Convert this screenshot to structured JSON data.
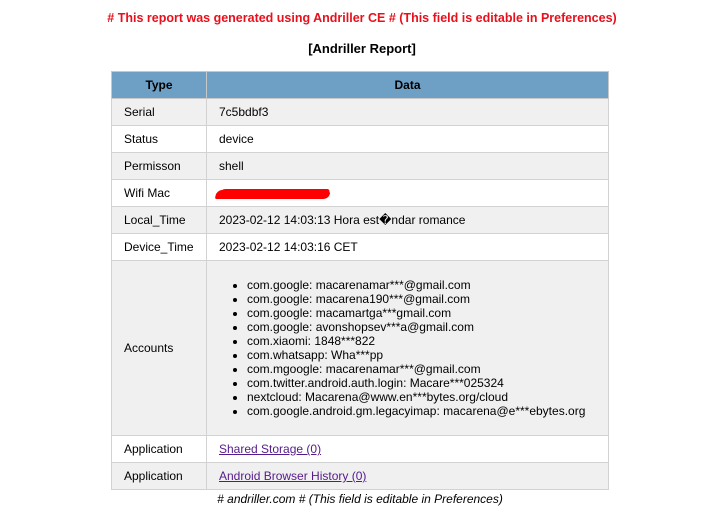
{
  "header": {
    "notice": "# This report was generated using Andriller CE # (This field is editable in Preferences)",
    "title": "[Andriller Report]"
  },
  "table": {
    "columns": [
      "Type",
      "Data"
    ],
    "rows": {
      "serial": {
        "type": "Serial",
        "data": "7c5bdbf3"
      },
      "status": {
        "type": "Status",
        "data": "device"
      },
      "permission": {
        "type": "Permisson",
        "data": "shell"
      },
      "wifi_mac": {
        "type": "Wifi Mac",
        "data": ""
      },
      "local_time": {
        "type": "Local_Time",
        "data": "2023-02-12 14:03:13 Hora est�ndar romance"
      },
      "device_time": {
        "type": "Device_Time",
        "data": "2023-02-12 14:03:16 CET"
      },
      "accounts": {
        "type": "Accounts",
        "items": [
          "com.google: macarenamar***@gmail.com",
          "com.google: macarena190***@gmail.com",
          "com.google: macamartga***gmail.com",
          "com.google: avonshopsev***a@gmail.com",
          "com.xiaomi: 1848***822",
          "com.whatsapp: Wha***pp",
          "com.mgoogle: macarenamar***@gmail.com",
          "com.twitter.android.auth.login: Macare***025324",
          "nextcloud: Macarena@www.en***bytes.org/cloud",
          "com.google.android.gm.legacyimap: macarena@e***ebytes.org"
        ]
      },
      "app_shared": {
        "type": "Application",
        "link": "Shared Storage (0)"
      },
      "app_browser": {
        "type": "Application",
        "link": "Android Browser History (0)"
      }
    }
  },
  "footer": {
    "notice": "# andriller.com # (This field is editable in Preferences)"
  },
  "colors": {
    "notice_red": "#e8101b",
    "header_blue": "#6ea0c6",
    "redaction": "#ff0000",
    "link": "#551a8b"
  }
}
